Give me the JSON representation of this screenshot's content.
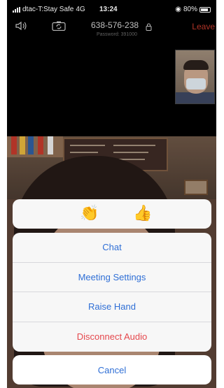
{
  "status_bar": {
    "carrier": "dtac-T:Stay Safe",
    "network": "4G",
    "time": "13:24",
    "battery": "80%"
  },
  "meeting": {
    "meeting_id": "638-576-238",
    "password": "Password: 391000",
    "leave_label": "Leave"
  },
  "reactions": {
    "clap": "👏",
    "thumbs_up": "👍"
  },
  "menu": {
    "items": [
      {
        "label": "Chat"
      },
      {
        "label": "Meeting Settings"
      },
      {
        "label": "Raise Hand"
      },
      {
        "label": "Disconnect Audio"
      }
    ],
    "cancel_label": "Cancel"
  },
  "colors": {
    "accent": "#2f6fd6",
    "danger": "#e5484d",
    "leave": "#c0392b"
  }
}
